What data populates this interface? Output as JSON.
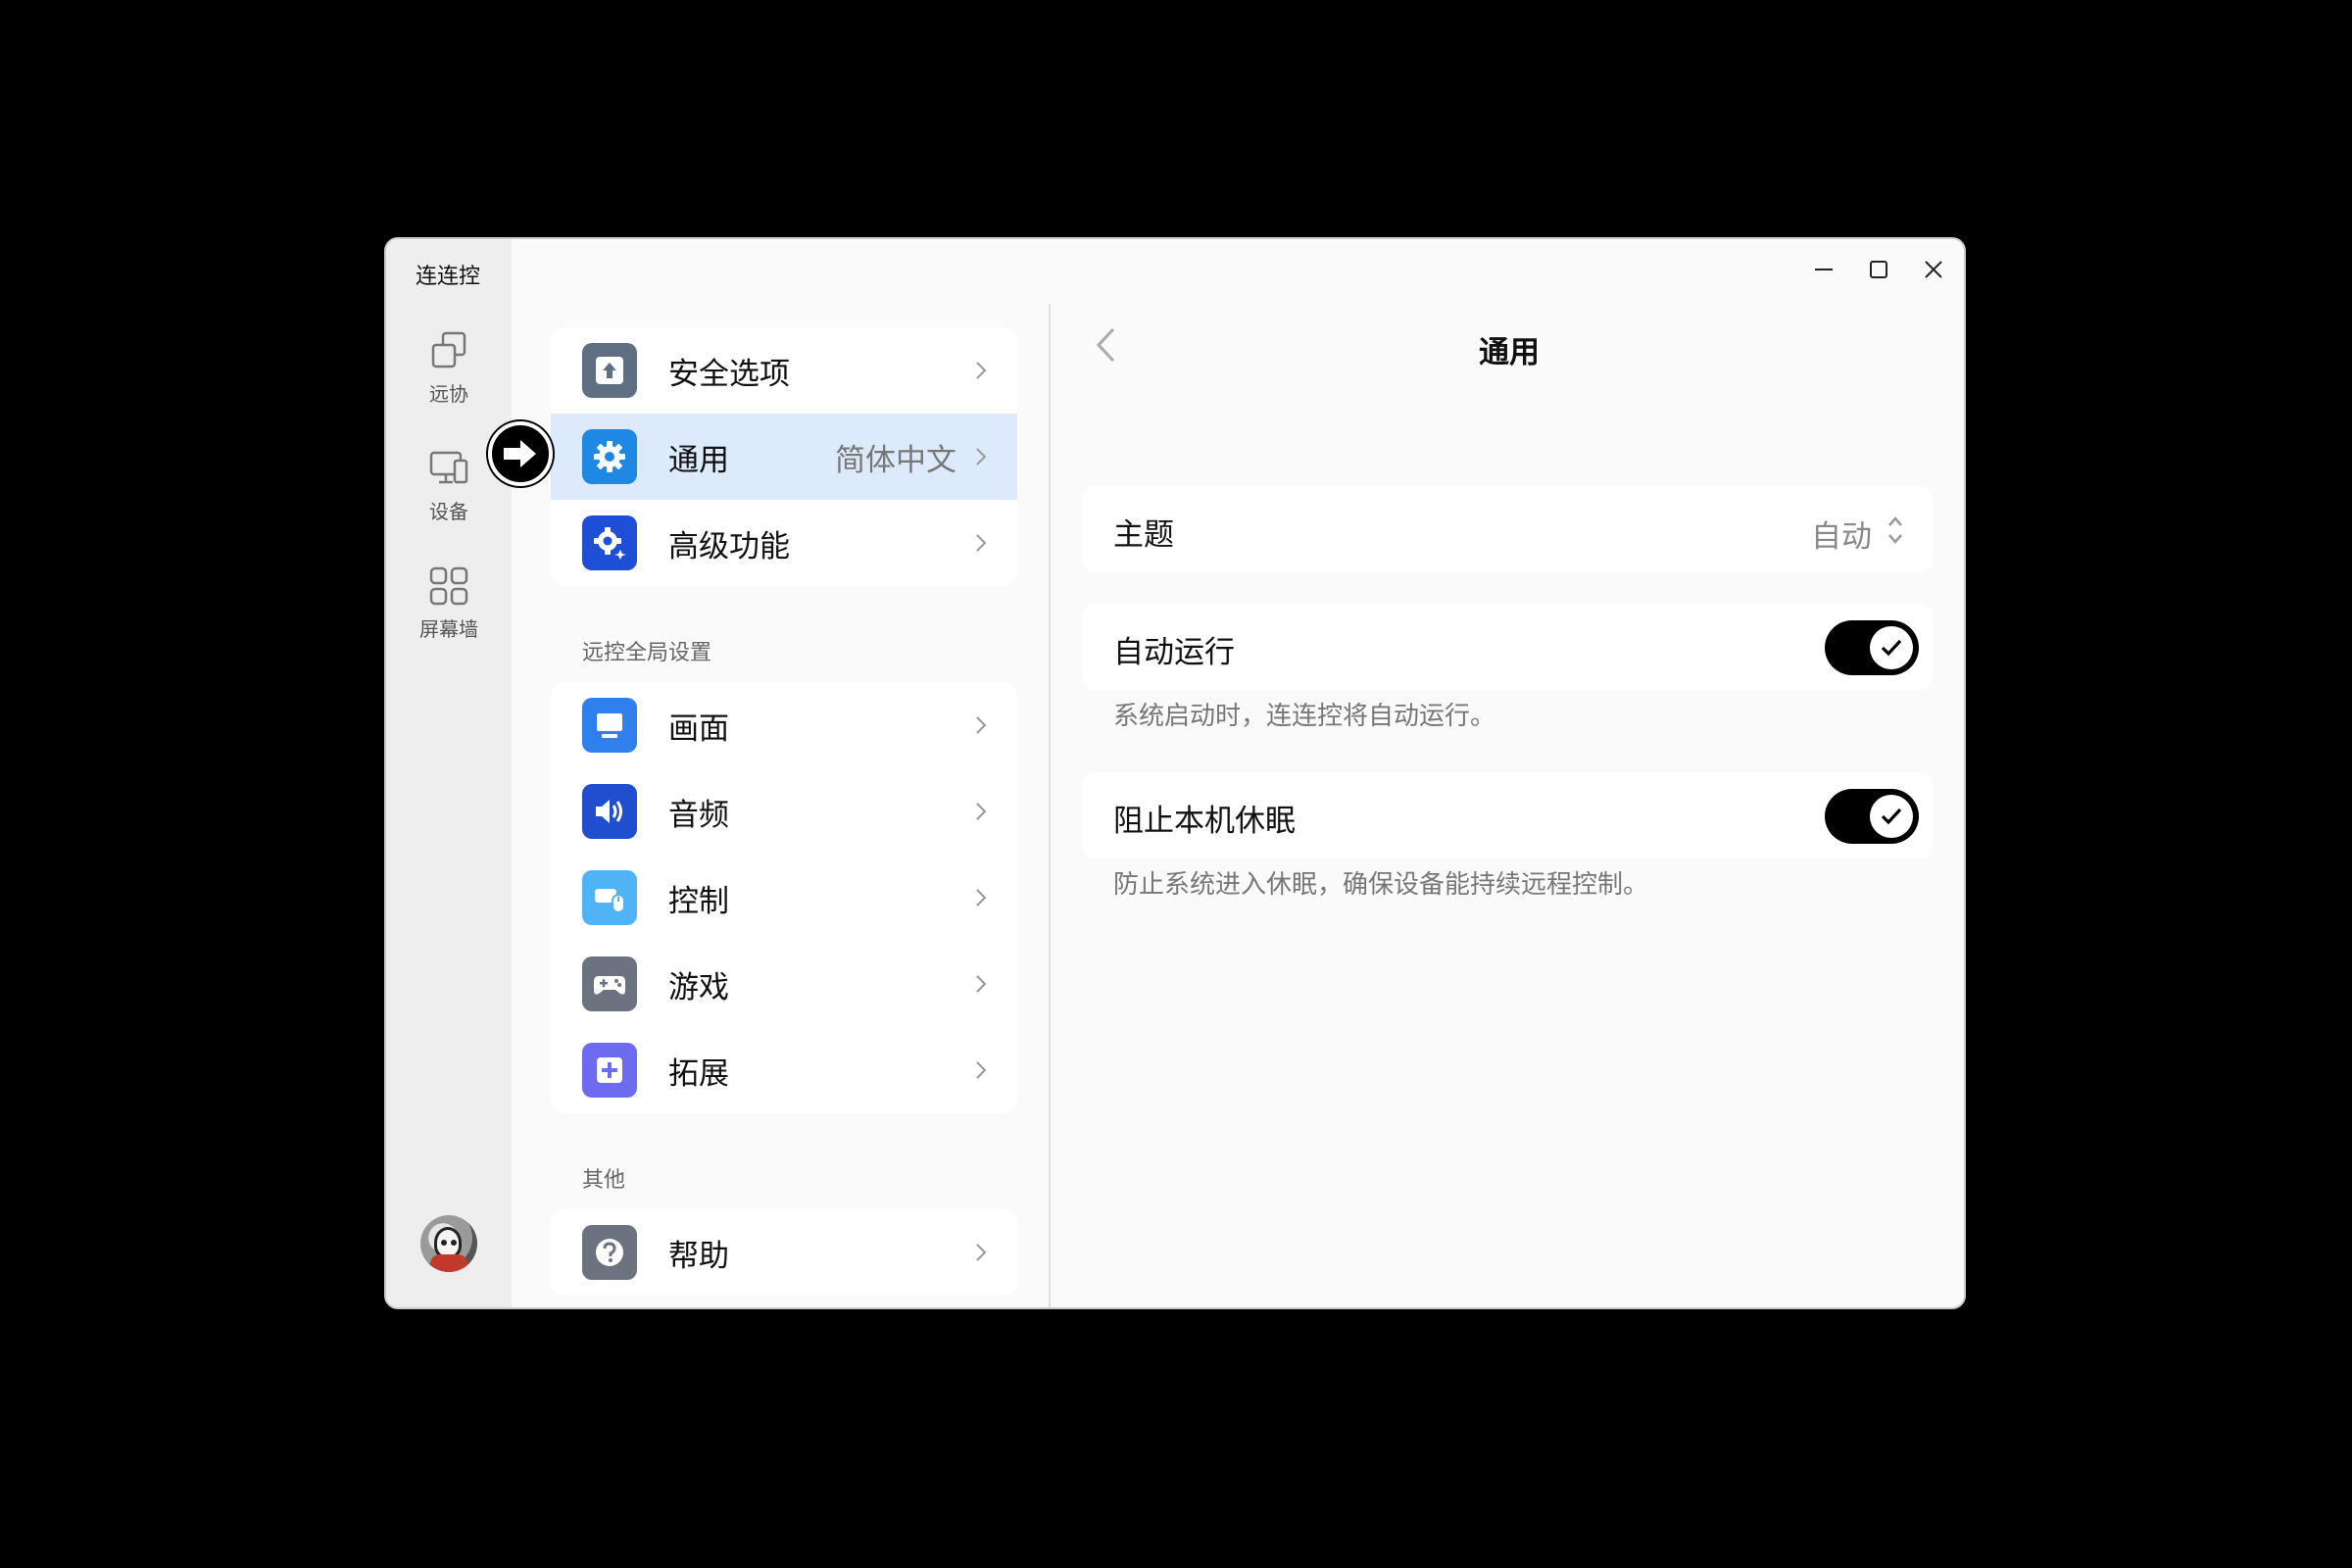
{
  "window": {
    "title": "连连控"
  },
  "rail": {
    "items": [
      {
        "label": "远协",
        "icon": "copy-windows-icon"
      },
      {
        "label": "设备",
        "icon": "devices-icon"
      },
      {
        "label": "屏幕墙",
        "icon": "grid-icon"
      }
    ]
  },
  "settings": {
    "top_items": [
      {
        "label": "安全选项",
        "value": "",
        "icon": "upload-shield-icon",
        "color": "#5f6f82"
      },
      {
        "label": "通用",
        "value": "简体中文",
        "icon": "gear-icon",
        "color": "#1e88e5",
        "active": true
      },
      {
        "label": "高级功能",
        "value": "",
        "icon": "advanced-gear-icon",
        "color": "#1e4fd6"
      }
    ],
    "section_remote": "远控全局设置",
    "remote_items": [
      {
        "label": "画面",
        "icon": "monitor-icon",
        "color": "#2f80ed"
      },
      {
        "label": "音频",
        "icon": "speaker-icon",
        "color": "#1f4fcf"
      },
      {
        "label": "控制",
        "icon": "mouse-keyboard-icon",
        "color": "#4fb3f6"
      },
      {
        "label": "游戏",
        "icon": "gamepad-icon",
        "color": "#6b7280"
      },
      {
        "label": "拓展",
        "icon": "plus-icon",
        "color": "#6d6cf0"
      }
    ],
    "section_other": "其他",
    "other_items": [
      {
        "label": "帮助",
        "icon": "help-icon",
        "color": "#6b7280"
      }
    ]
  },
  "detail": {
    "title": "通用",
    "theme": {
      "label": "主题",
      "value": "自动"
    },
    "autorun": {
      "label": "自动运行",
      "on": true,
      "description": "系统启动时，连连控将自动运行。"
    },
    "nosleep": {
      "label": "阻止本机休眠",
      "on": true,
      "description": "防止系统进入休眠，确保设备能持续远程控制。"
    }
  }
}
